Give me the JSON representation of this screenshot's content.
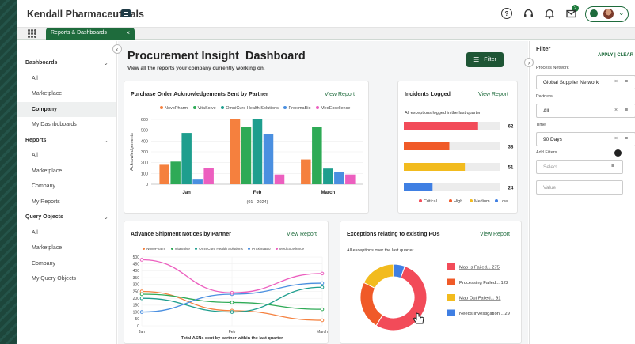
{
  "header": {
    "brand": "Kendall Pharmaceuticals",
    "notification_count": "2"
  },
  "tabbar": {
    "tab_label": "Reports & Dashboards",
    "close": "×"
  },
  "sidebar": {
    "collapse": "‹",
    "sections": [
      {
        "label": "Dashboards",
        "items": [
          "All",
          "Marketplace",
          "Company",
          "My Dashboboards"
        ]
      },
      {
        "label": "Reports",
        "items": [
          "All",
          "Marketplace",
          "Company",
          "My Reports"
        ]
      },
      {
        "label": "Query Objects",
        "items": [
          "All",
          "Marketplace",
          "Company",
          "My Query Objects"
        ]
      }
    ],
    "active": "Company"
  },
  "main": {
    "title": "Procurement Insight  Dashboard",
    "subtitle": "View all the reports your company currently working on.",
    "filter_label": "Filter",
    "view_report": "View Report"
  },
  "cards": {
    "po_ack": {
      "title": "Purchase Order Acknowledgements Sent by Partner",
      "ylabel": "Acknowledgements",
      "xcaption": "(01 - 2024)"
    },
    "incidents": {
      "title": "Incidents Logged",
      "subtitle": "All exceptions logged in the  last quarter"
    },
    "asn": {
      "title": "Advance Shipment Notices by Partner",
      "xcaption": "Total ASNs sent by partner within the last quarter"
    },
    "exceptions": {
      "title": "Exceptions relating to existing POs",
      "subtitle": "All exceptions over the last quarter"
    }
  },
  "chart_data": [
    {
      "type": "bar",
      "title": "Purchase Order Acknowledgements Sent by Partner",
      "ylabel": "Acknowledgements",
      "xlabel": "(01 - 2024)",
      "categories": [
        "Jan",
        "Feb",
        "March"
      ],
      "ylim": [
        0,
        600
      ],
      "yticks": [
        0,
        100,
        200,
        300,
        400,
        500,
        600
      ],
      "series": [
        {
          "name": "NovoPharm",
          "color": "#f5803e",
          "values": [
            180,
            600,
            230
          ]
        },
        {
          "name": "VitaSolve",
          "color": "#2eaa56",
          "values": [
            210,
            530,
            530
          ]
        },
        {
          "name": "OmniCure Health Solutions",
          "color": "#1e9e8e",
          "values": [
            475,
            605,
            145
          ]
        },
        {
          "name": "ProximaBio",
          "color": "#4a8fe0",
          "values": [
            50,
            465,
            115
          ]
        },
        {
          "name": "MedExcellence",
          "color": "#ec5fbf",
          "values": [
            150,
            90,
            90
          ]
        }
      ]
    },
    {
      "type": "bar",
      "title": "Incidents Logged",
      "orientation": "horizontal",
      "categories": [
        "Critical",
        "High",
        "Medium",
        "Low"
      ],
      "values": [
        62,
        38,
        51,
        24
      ],
      "colors": [
        "#f24b59",
        "#f05a28",
        "#f2bb1e",
        "#3f7fe3"
      ],
      "max": 80
    },
    {
      "type": "line",
      "title": "Advance Shipment Notices by Partner",
      "xlabel": "Total ASNs sent by partner within the last quarter",
      "x": [
        "Jan",
        "Feb",
        "March"
      ],
      "ylim": [
        0,
        500
      ],
      "yticks": [
        0,
        50,
        100,
        150,
        200,
        250,
        300,
        350,
        400,
        450,
        500
      ],
      "series": [
        {
          "name": "NovoPharm",
          "color": "#f5803e",
          "values": [
            250,
            110,
            40
          ]
        },
        {
          "name": "VitaSolve",
          "color": "#2eaa56",
          "values": [
            230,
            170,
            120
          ]
        },
        {
          "name": "OmniCure Health Solutions",
          "color": "#1e9e8e",
          "values": [
            200,
            100,
            280
          ]
        },
        {
          "name": "ProximaBio",
          "color": "#4a8fe0",
          "values": [
            100,
            230,
            310
          ]
        },
        {
          "name": "MedExcellence",
          "color": "#ec5fbf",
          "values": [
            480,
            240,
            380
          ]
        }
      ]
    },
    {
      "type": "pie",
      "title": "Exceptions relating to existing POs",
      "donut": true,
      "labels": [
        "Map Is Failed",
        "Processing Failed",
        "Map Out Failed",
        "Needs Investigation"
      ],
      "values": [
        275,
        122,
        91,
        29
      ],
      "colors": [
        "#f24b59",
        "#f05a28",
        "#f2bb1e",
        "#3f7fe3"
      ],
      "legend": [
        "Map Is Failed... 275",
        "Processing Failed... 122",
        "Map Out Failed... 91",
        "Needs Investigation... 29"
      ]
    }
  ],
  "filter_panel": {
    "title": "Filter",
    "actions": "APPLY | CLEAR",
    "process_network_label": "Process Network",
    "process_network_value": "Global Supplier Network",
    "partners_label": "Partners",
    "partners_value": "All",
    "time_label": "Time",
    "time_value": "90 Days",
    "add_filters_label": "Add Filters",
    "select_placeholder": "Select",
    "value_placeholder": "Value"
  }
}
